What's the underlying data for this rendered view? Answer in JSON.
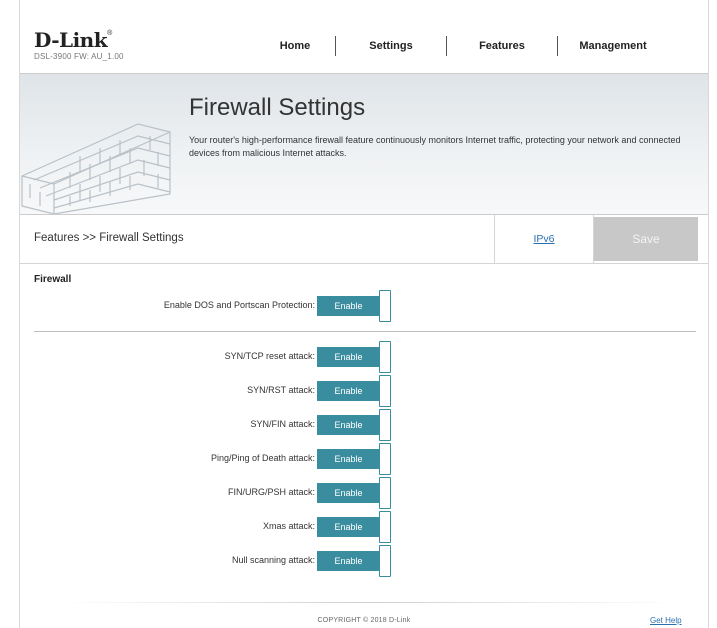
{
  "header": {
    "brand": "D-Link",
    "model": "DSL-3900  FW: AU_1.00",
    "nav": [
      "Home",
      "Settings",
      "Features",
      "Management"
    ]
  },
  "banner": {
    "title": "Firewall Settings",
    "description": "Your router's high-performance firewall feature continuously monitors Internet traffic, protecting your network and connected devices from malicious Internet attacks."
  },
  "toolbar": {
    "breadcrumb": "Features >> Firewall Settings",
    "ipv6_label": "IPv6",
    "save_label": "Save"
  },
  "firewall": {
    "section_title": "Firewall",
    "dos": {
      "label": "Enable DOS and Portscan Protection:",
      "state": "Enable"
    },
    "attacks": [
      {
        "label": "SYN/TCP reset attack:",
        "state": "Enable"
      },
      {
        "label": "SYN/RST attack:",
        "state": "Enable"
      },
      {
        "label": "SYN/FIN attack:",
        "state": "Enable"
      },
      {
        "label": "Ping/Ping of Death attack:",
        "state": "Enable"
      },
      {
        "label": "FIN/URG/PSH attack:",
        "state": "Enable"
      },
      {
        "label": "Xmas attack:",
        "state": "Enable"
      },
      {
        "label": "Null scanning attack:",
        "state": "Enable"
      }
    ]
  },
  "footer": {
    "copyright": "COPYRIGHT © 2018 D-Link",
    "help_label": "Get Help"
  },
  "colors": {
    "toggle_on": "#3a8d9e",
    "link": "#2a6fb0",
    "save_disabled": "#c8c8c8"
  }
}
